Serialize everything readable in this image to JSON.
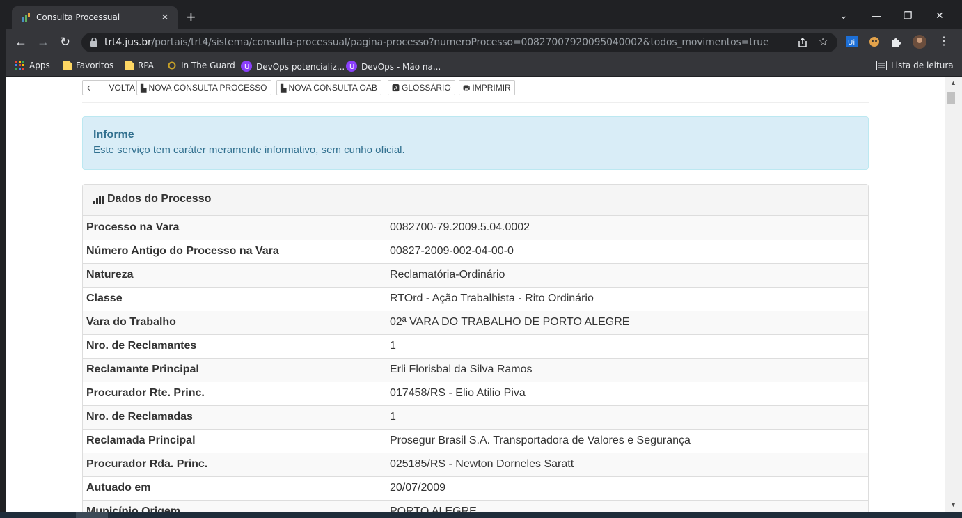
{
  "browser": {
    "tab_title": "Consulta Processual",
    "url_host": "trt4.jus.br",
    "url_path": "/portais/trt4/sistema/consulta-processual/pagina-processo?numeroProcesso=00827007920095040002&todos_movimentos=true",
    "bookmarks": [
      "Apps",
      "Favoritos",
      "RPA",
      "In The Guard",
      "DevOps potencializ...",
      "DevOps - Mão na...",
      "Lista de leitura"
    ]
  },
  "page": {
    "buttons": [
      "VOLTAR",
      "NOVA CONSULTA PROCESSO",
      "NOVA CONSULTA OAB",
      "GLOSSÁRIO",
      "IMPRIMIR"
    ],
    "alert": {
      "heading": "Informe",
      "body": "Este serviço tem caráter meramente informativo, sem cunho oficial."
    },
    "panel_title": "Dados do Processo",
    "rows": [
      {
        "label": "Processo na Vara",
        "value": "0082700-79.2009.5.04.0002"
      },
      {
        "label": "Número Antigo do Processo na Vara",
        "value": "00827-2009-002-04-00-0"
      },
      {
        "label": "Natureza",
        "value": "Reclamatória-Ordinário"
      },
      {
        "label": "Classe",
        "value": "RTOrd - Ação Trabalhista - Rito Ordinário"
      },
      {
        "label": "Vara do Trabalho",
        "value": "02ª VARA DO TRABALHO DE PORTO ALEGRE"
      },
      {
        "label": "Nro. de Reclamantes",
        "value": "1"
      },
      {
        "label": "Reclamante Principal",
        "value": "Erli Florisbal da Silva Ramos"
      },
      {
        "label": "Procurador Rte. Princ.",
        "value": "017458/RS - Elio Atilio Piva"
      },
      {
        "label": "Nro. de Reclamadas",
        "value": "1"
      },
      {
        "label": "Reclamada Principal",
        "value": "Prosegur Brasil S.A. Transportadora de Valores e Segurança"
      },
      {
        "label": "Procurador Rda. Princ.",
        "value": "025185/RS - Newton Dorneles Saratt"
      },
      {
        "label": "Autuado em",
        "value": "20/07/2009"
      },
      {
        "label": "Município Origem",
        "value": "PORTO ALEGRE"
      }
    ]
  },
  "colors": {
    "alert_bg": "#d9edf7",
    "alert_text": "#31708f",
    "chrome_dark": "#202124",
    "chrome_toolbar": "#35363a"
  }
}
